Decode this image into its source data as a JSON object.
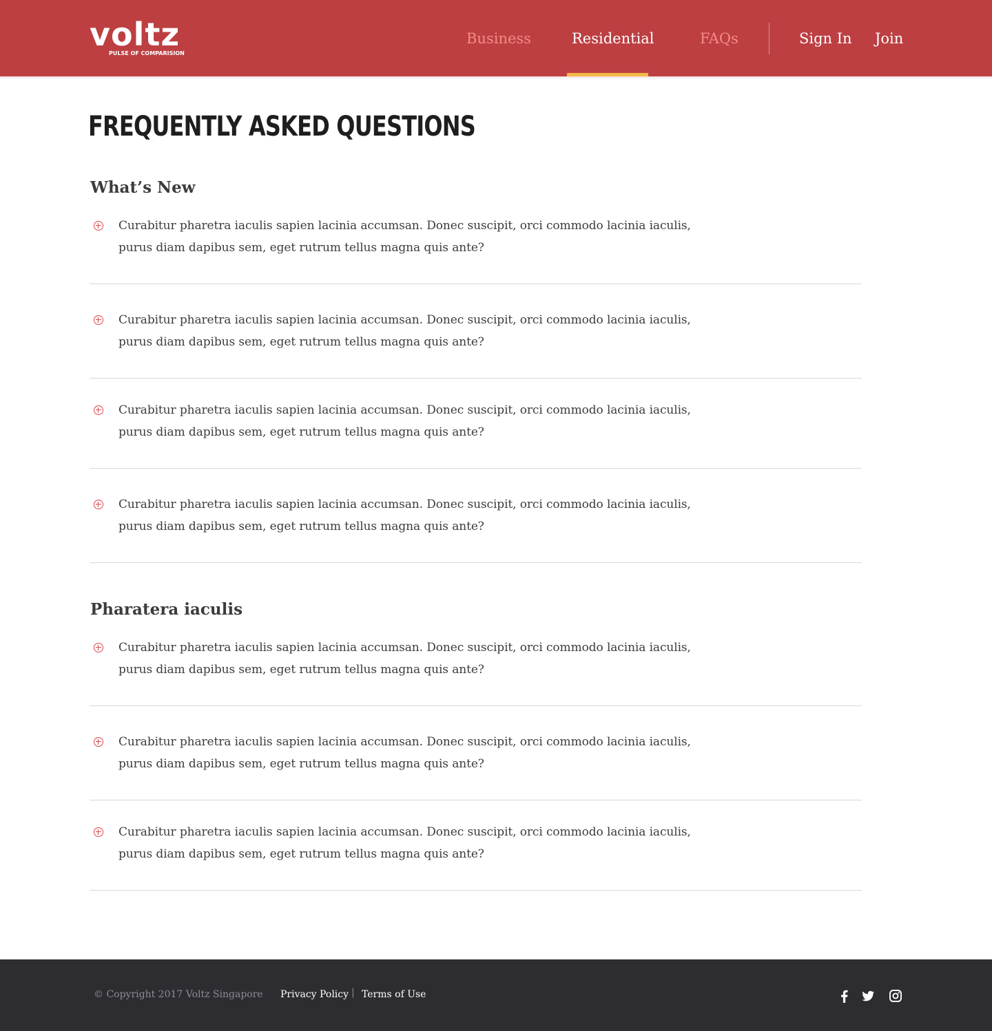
{
  "brand": {
    "logo_word": "voltz",
    "tagline": "PULSE OF COMPARISION",
    "header_color": "#bd3f42",
    "accent_color": "#f5b947",
    "icon_color": "#d9474b"
  },
  "nav": {
    "business": "Business",
    "residential": "Residential",
    "faqs": "FAQs",
    "sign_in": "Sign In",
    "join": "Join",
    "active": "Residential"
  },
  "page": {
    "title": "FREQUENTLY ASKED QUESTIONS"
  },
  "sections": [
    {
      "title": "What’s New",
      "questions": [
        "Curabitur pharetra iaculis sapien lacinia accumsan. Donec suscipit, orci commodo lacinia iaculis, purus diam dapibus sem, eget rutrum tellus magna quis ante?",
        "Curabitur pharetra iaculis sapien lacinia accumsan. Donec suscipit, orci commodo lacinia iaculis, purus diam dapibus sem, eget rutrum tellus magna quis ante?",
        "Curabitur pharetra iaculis sapien lacinia accumsan. Donec suscipit, orci commodo lacinia iaculis, purus diam dapibus sem, eget rutrum tellus magna quis ante?",
        "Curabitur pharetra iaculis sapien lacinia accumsan. Donec suscipit, orci commodo lacinia iaculis, purus diam dapibus sem, eget rutrum tellus magna quis ante?"
      ]
    },
    {
      "title": "Pharatera iaculis",
      "questions": [
        "Curabitur pharetra iaculis sapien lacinia accumsan. Donec suscipit, orci commodo lacinia iaculis, purus diam dapibus sem, eget rutrum tellus magna quis ante?",
        "Curabitur pharetra iaculis sapien lacinia accumsan. Donec suscipit, orci commodo lacinia iaculis, purus diam dapibus sem, eget rutrum tellus magna quis ante?",
        "Curabitur pharetra iaculis sapien lacinia accumsan. Donec suscipit, orci commodo lacinia iaculis, purus diam dapibus sem, eget rutrum tellus magna quis ante?"
      ]
    }
  ],
  "footer": {
    "copyright": "© Copyright 2017 Voltz Singapore",
    "privacy": "Privacy Policy",
    "separator": "|",
    "terms": "Terms of Use",
    "social_icons": [
      "facebook-icon",
      "twitter-icon",
      "instagram-icon"
    ],
    "background": "#2d2c31"
  }
}
